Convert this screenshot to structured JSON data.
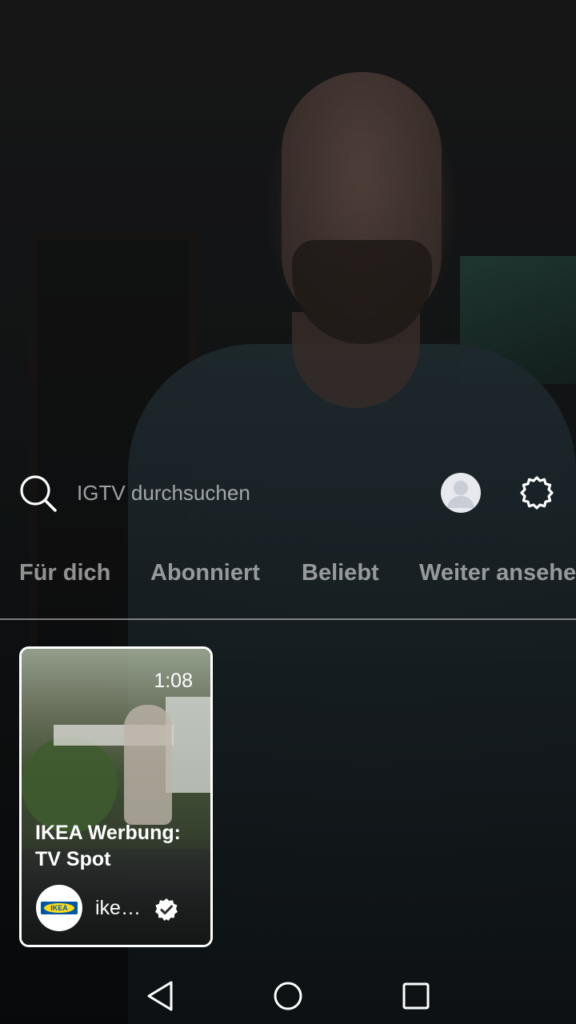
{
  "search": {
    "placeholder": "IGTV durchsuchen"
  },
  "tabs": [
    {
      "label": "Für dich"
    },
    {
      "label": "Abonniert"
    },
    {
      "label": "Beliebt"
    },
    {
      "label": "Weiter ansehe"
    }
  ],
  "video_card": {
    "duration": "1:08",
    "title": "IKEA Werbung: TV Spot",
    "channel_name": "ike…",
    "channel_logo_text": "IKEA",
    "verified": true
  },
  "icons": {
    "search": "search-icon",
    "profile": "profile-avatar-icon",
    "settings": "settings-gear-icon",
    "verified": "verified-badge-icon",
    "back": "nav-back-icon",
    "home": "nav-home-icon",
    "recents": "nav-recents-icon"
  },
  "colors": {
    "ikea_blue": "#0058a3",
    "ikea_yellow": "#ffda1a"
  }
}
